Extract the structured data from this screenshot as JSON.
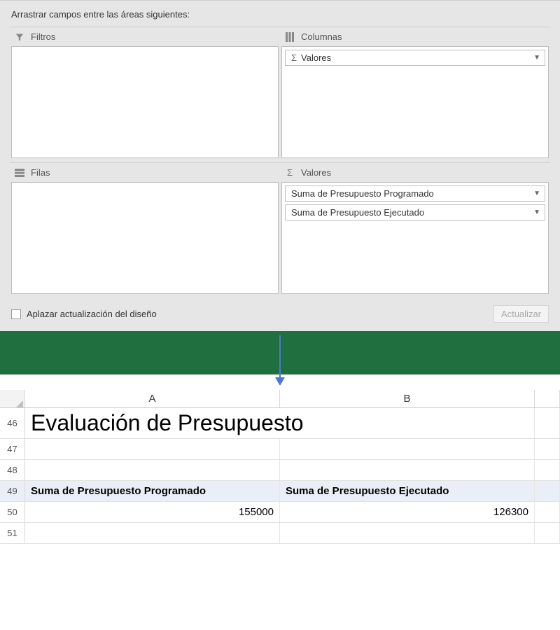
{
  "pivot": {
    "hint": "Arrastrar campos entre las áreas siguientes:",
    "areas": {
      "filters": {
        "label": "Filtros"
      },
      "columns": {
        "label": "Columnas",
        "items": [
          "Valores"
        ]
      },
      "rows": {
        "label": "Filas"
      },
      "values": {
        "label": "Valores",
        "items": [
          "Suma de Presupuesto Programado",
          "Suma de Presupuesto Ejecutado"
        ]
      }
    },
    "defer_label": "Aplazar actualización del diseño",
    "update_label": "Actualizar"
  },
  "sheet": {
    "columns": [
      "A",
      "B"
    ],
    "title": "Evaluación de Presupuesto",
    "header_row": [
      "Suma de Presupuesto Programado",
      "Suma de Presupuesto Ejecutado"
    ],
    "data_row": [
      "155000",
      "126300"
    ],
    "row_numbers": [
      "46",
      "47",
      "48",
      "49",
      "50",
      "51"
    ]
  }
}
